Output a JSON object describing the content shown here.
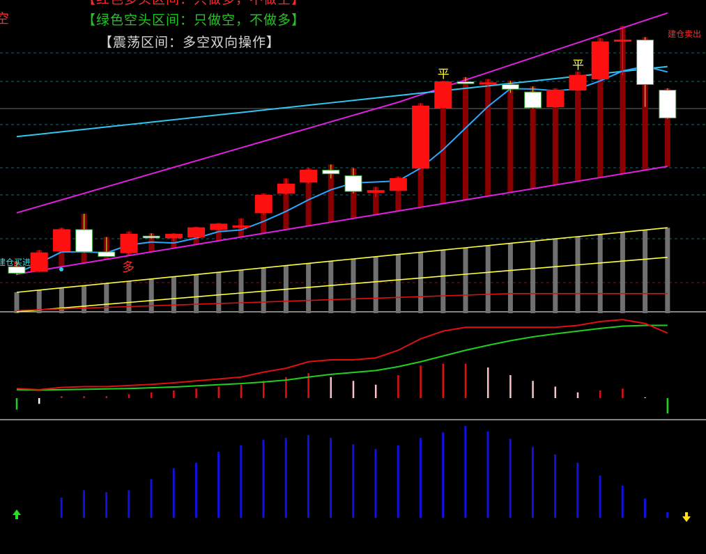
{
  "legend": {
    "red_zone": "【红色多头区间：只做多，不做空】",
    "green_zone": "【绿色空头区间：只做空，不做多】",
    "range_zone": "【震荡区间：多空双向操作】",
    "edge_char": "空"
  },
  "signals": {
    "buy_text": "建仓买进",
    "sell_text": "建仓卖出",
    "flat_text": "平",
    "long_text": "多"
  },
  "colors": {
    "up": "#ff1010",
    "down": "#ffffff",
    "band": "#e020e0",
    "ma_slow": "#30c8f0",
    "ma_fast": "#2aa8ff",
    "dark_bar": "#8a0000",
    "dif": "#e01010",
    "dea": "#20d020",
    "volume": "#1010e0"
  },
  "chart_data": [
    {
      "type": "candlestick",
      "series_name": "",
      "candles": [
        {
          "o": 2.0,
          "h": 2.3,
          "l": 1.55,
          "c": 1.65
        },
        {
          "o": 1.75,
          "h": 2.9,
          "l": 1.7,
          "c": 2.75
        },
        {
          "o": 2.85,
          "h": 4.1,
          "l": 2.8,
          "c": 4.0
        },
        {
          "o": 4.0,
          "h": 4.85,
          "l": 2.75,
          "c": 2.8
        },
        {
          "o": 2.8,
          "h": 3.6,
          "l": 2.55,
          "c": 2.55
        },
        {
          "o": 2.75,
          "h": 3.9,
          "l": 2.65,
          "c": 3.75
        },
        {
          "o": 3.65,
          "h": 3.8,
          "l": 3.5,
          "c": 3.55
        },
        {
          "o": 3.55,
          "h": 3.8,
          "l": 3.35,
          "c": 3.75
        },
        {
          "o": 3.6,
          "h": 4.15,
          "l": 3.45,
          "c": 4.1
        },
        {
          "o": 4.0,
          "h": 4.35,
          "l": 3.9,
          "c": 4.3
        },
        {
          "o": 4.2,
          "h": 4.6,
          "l": 4.0,
          "c": 4.2
        },
        {
          "o": 4.9,
          "h": 5.95,
          "l": 4.8,
          "c": 5.85
        },
        {
          "o": 5.95,
          "h": 6.75,
          "l": 5.85,
          "c": 6.45
        },
        {
          "o": 6.55,
          "h": 7.3,
          "l": 6.45,
          "c": 7.2
        },
        {
          "o": 7.2,
          "h": 7.5,
          "l": 6.75,
          "c": 7.0
        },
        {
          "o": 6.9,
          "h": 7.3,
          "l": 5.95,
          "c": 6.05
        },
        {
          "o": 6.0,
          "h": 6.3,
          "l": 5.75,
          "c": 6.1
        },
        {
          "o": 6.1,
          "h": 6.85,
          "l": 6.05,
          "c": 6.75
        },
        {
          "o": 7.3,
          "h": 10.8,
          "l": 7.25,
          "c": 10.65
        },
        {
          "o": 10.55,
          "h": 12.0,
          "l": 10.5,
          "c": 11.95
        },
        {
          "o": 11.95,
          "h": 12.2,
          "l": 11.85,
          "c": 11.85
        },
        {
          "o": 11.9,
          "h": 12.1,
          "l": 11.7,
          "c": 11.9
        },
        {
          "o": 11.8,
          "h": 12.0,
          "l": 11.35,
          "c": 11.55
        },
        {
          "o": 11.4,
          "h": 11.7,
          "l": 10.5,
          "c": 10.55
        },
        {
          "o": 10.6,
          "h": 11.6,
          "l": 10.55,
          "c": 11.5
        },
        {
          "o": 11.5,
          "h": 12.5,
          "l": 11.45,
          "c": 12.3
        },
        {
          "o": 12.1,
          "h": 14.3,
          "l": 12.05,
          "c": 14.1
        },
        {
          "o": 14.2,
          "h": 14.95,
          "l": 12.3,
          "c": 14.2
        },
        {
          "o": 14.2,
          "h": 14.35,
          "l": 10.6,
          "c": 11.8
        },
        {
          "o": 11.5,
          "h": 11.6,
          "l": 9.95,
          "c": 10.0
        }
      ],
      "flat_signals": [
        19,
        25
      ],
      "buy_signal": 0,
      "sell_signal": 29,
      "long_label": 5
    },
    {
      "type": "bar",
      "series_name": "",
      "values": [
        -0.3,
        -0.15,
        0.05,
        0.05,
        0.05,
        0.1,
        0.15,
        0.2,
        0.25,
        0.3,
        0.35,
        0.45,
        0.55,
        0.65,
        0.55,
        0.45,
        0.35,
        0.6,
        0.85,
        0.9,
        0.9,
        0.8,
        0.6,
        0.45,
        0.3,
        0.15,
        0.2,
        0.25,
        0.02,
        -0.4
      ],
      "dif": [
        0.25,
        0.22,
        0.28,
        0.3,
        0.3,
        0.33,
        0.36,
        0.4,
        0.45,
        0.5,
        0.55,
        0.68,
        0.78,
        0.95,
        1.0,
        1.0,
        1.05,
        1.25,
        1.55,
        1.75,
        1.85,
        1.85,
        1.85,
        1.85,
        1.85,
        1.9,
        2.0,
        2.05,
        1.95,
        1.7
      ],
      "dea": [
        0.22,
        0.21,
        0.22,
        0.23,
        0.24,
        0.25,
        0.27,
        0.29,
        0.32,
        0.35,
        0.38,
        0.42,
        0.47,
        0.55,
        0.62,
        0.67,
        0.72,
        0.82,
        0.95,
        1.1,
        1.25,
        1.38,
        1.5,
        1.6,
        1.68,
        1.75,
        1.82,
        1.88,
        1.9,
        1.9
      ]
    },
    {
      "type": "bar",
      "series_name": "",
      "values": [
        0,
        0.22,
        0.3,
        0.28,
        0.3,
        0.42,
        0.54,
        0.6,
        0.72,
        0.79,
        0.85,
        0.87,
        0.9,
        0.87,
        0.8,
        0.75,
        0.79,
        0.87,
        0.93,
        1.0,
        0.94,
        0.86,
        0.77,
        0.69,
        0.6,
        0.46,
        0.35,
        0.21,
        0.06,
        0
      ],
      "up_arrow": 0,
      "down_arrow": 29
    }
  ]
}
